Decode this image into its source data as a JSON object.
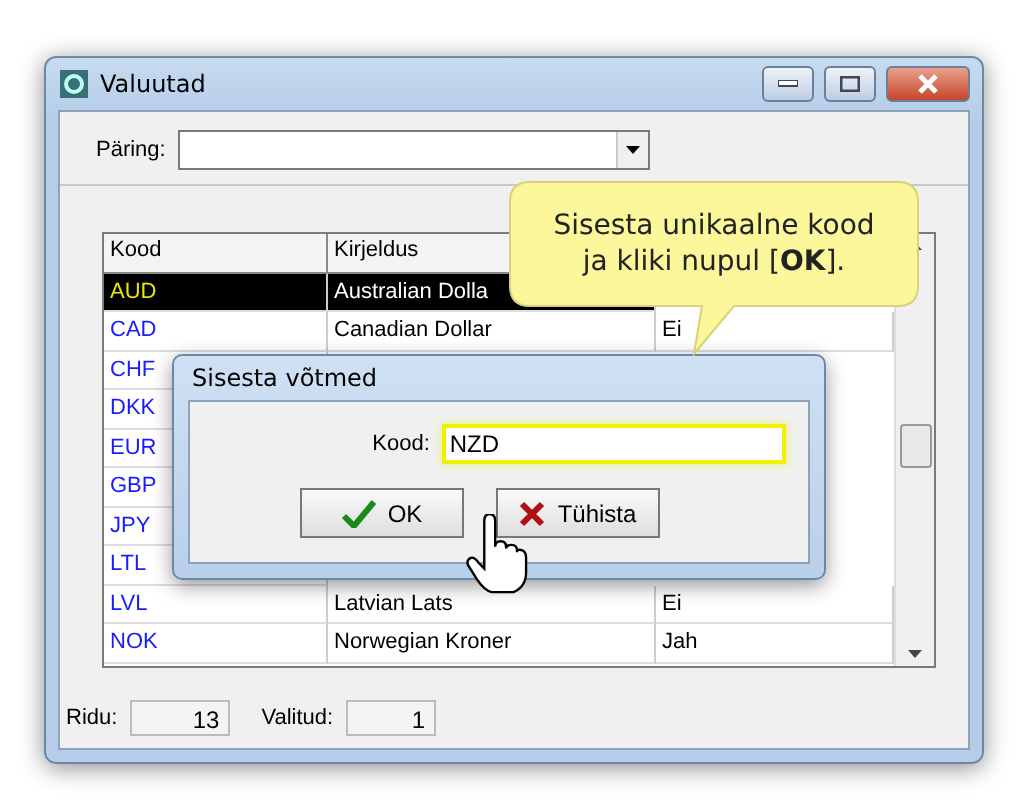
{
  "window": {
    "title": "Valuutad"
  },
  "query": {
    "label": "Päring:"
  },
  "grid": {
    "columns": [
      "Kood",
      "Kirjeldus"
    ],
    "rows": [
      {
        "code": "AUD",
        "description": "Australian Dolla",
        "selected": true
      },
      {
        "code": "CAD",
        "description": "Canadian Dollar",
        "column_3": "Ei",
        "selected": false
      },
      {
        "code": "CHF",
        "selected": false
      },
      {
        "code": "DKK",
        "selected": false
      },
      {
        "code": "EUR",
        "selected": false
      },
      {
        "code": "GBP",
        "selected": false
      },
      {
        "code": "JPY",
        "selected": false
      },
      {
        "code": "LTL",
        "selected": false
      },
      {
        "code": "LVL",
        "description": "Latvian Lats",
        "column_3": "Ei",
        "selected": false
      },
      {
        "code": "NOK",
        "description": "Norwegian Kroner",
        "column_3": "Jah",
        "selected": false
      }
    ]
  },
  "status_bar": {
    "rows_label": "Ridu:",
    "rows_value": "13",
    "selected_label": "Valitud:",
    "selected_value": "1"
  },
  "dialog": {
    "title": "Sisesta võtmed",
    "field_label": "Kood:",
    "field_value": "NZD",
    "buttons": [
      {
        "kind": "ok",
        "label": "OK"
      },
      {
        "kind": "cancel",
        "label": "Tühista"
      }
    ]
  },
  "callout": {
    "lines": [
      "Sisesta unikaalne kood",
      "ja kliki nupul [**OK**]."
    ]
  }
}
